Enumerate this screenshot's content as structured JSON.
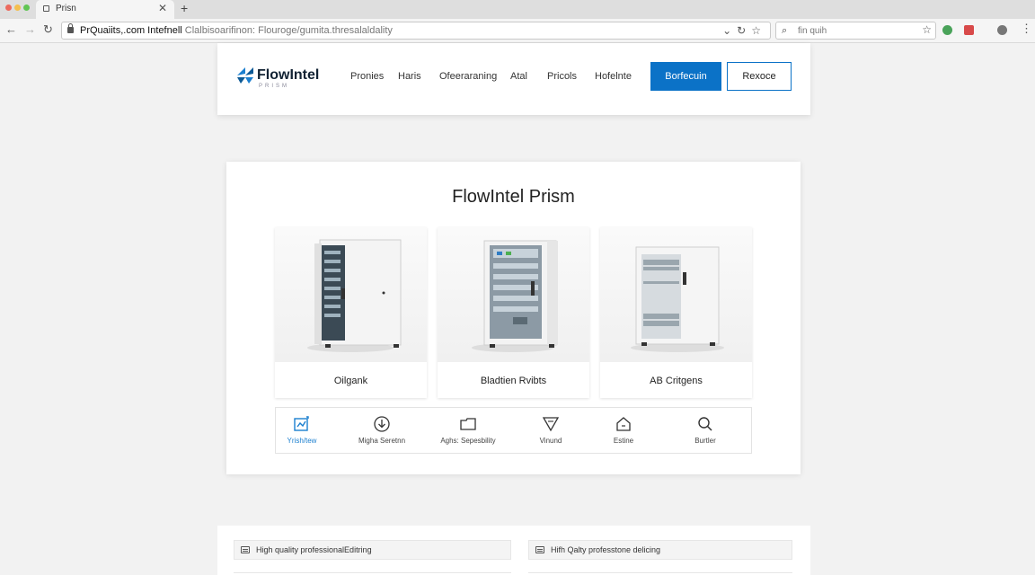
{
  "browser": {
    "tab_title": "Prisn",
    "tab_close": "✕",
    "new_tab": "+",
    "url_domain": "PrQuaiits,.com Intefnell",
    "url_path": "Clalbisoarifinon: Flouroge/​gumita.thresalaldality",
    "search_placeholder": "fin quih",
    "colors": {
      "close": "#ec6a5e",
      "minimize": "#f4bf4f",
      "maximize": "#61c554"
    }
  },
  "header": {
    "logo": "FlowIntel",
    "logo_sub": "PRISM",
    "nav": [
      "Pronies",
      "Haris",
      "Ofeeraraning",
      "Atal",
      "Pricols",
      "Hofelnte"
    ],
    "primary_button": "Borfecuin",
    "secondary_button": "Rexoce",
    "brand_color": "#0b72c7"
  },
  "main": {
    "title": "FlowIntel Prism",
    "products": [
      {
        "label": "Oilgank",
        "icon": "server-cabinet-open"
      },
      {
        "label": "Bladtien Rvibts",
        "icon": "server-cabinet-rack"
      },
      {
        "label": "AB Critgens",
        "icon": "server-cabinet-shelves"
      }
    ],
    "features": [
      {
        "label": "Yrish/tew",
        "icon": "dashboard-icon"
      },
      {
        "label": "Migha Seretnn",
        "icon": "download-circle-icon"
      },
      {
        "label": "Aghs: Sepesbility",
        "icon": "folder-icon"
      },
      {
        "label": "Vinund",
        "icon": "funnel-icon"
      },
      {
        "label": "Estine",
        "icon": "home-icon"
      },
      {
        "label": "Burtler",
        "icon": "search-icon"
      }
    ]
  },
  "bottom": {
    "items": [
      "High quality professionalEditring",
      "Hifh Qalty professtone delicing"
    ]
  }
}
